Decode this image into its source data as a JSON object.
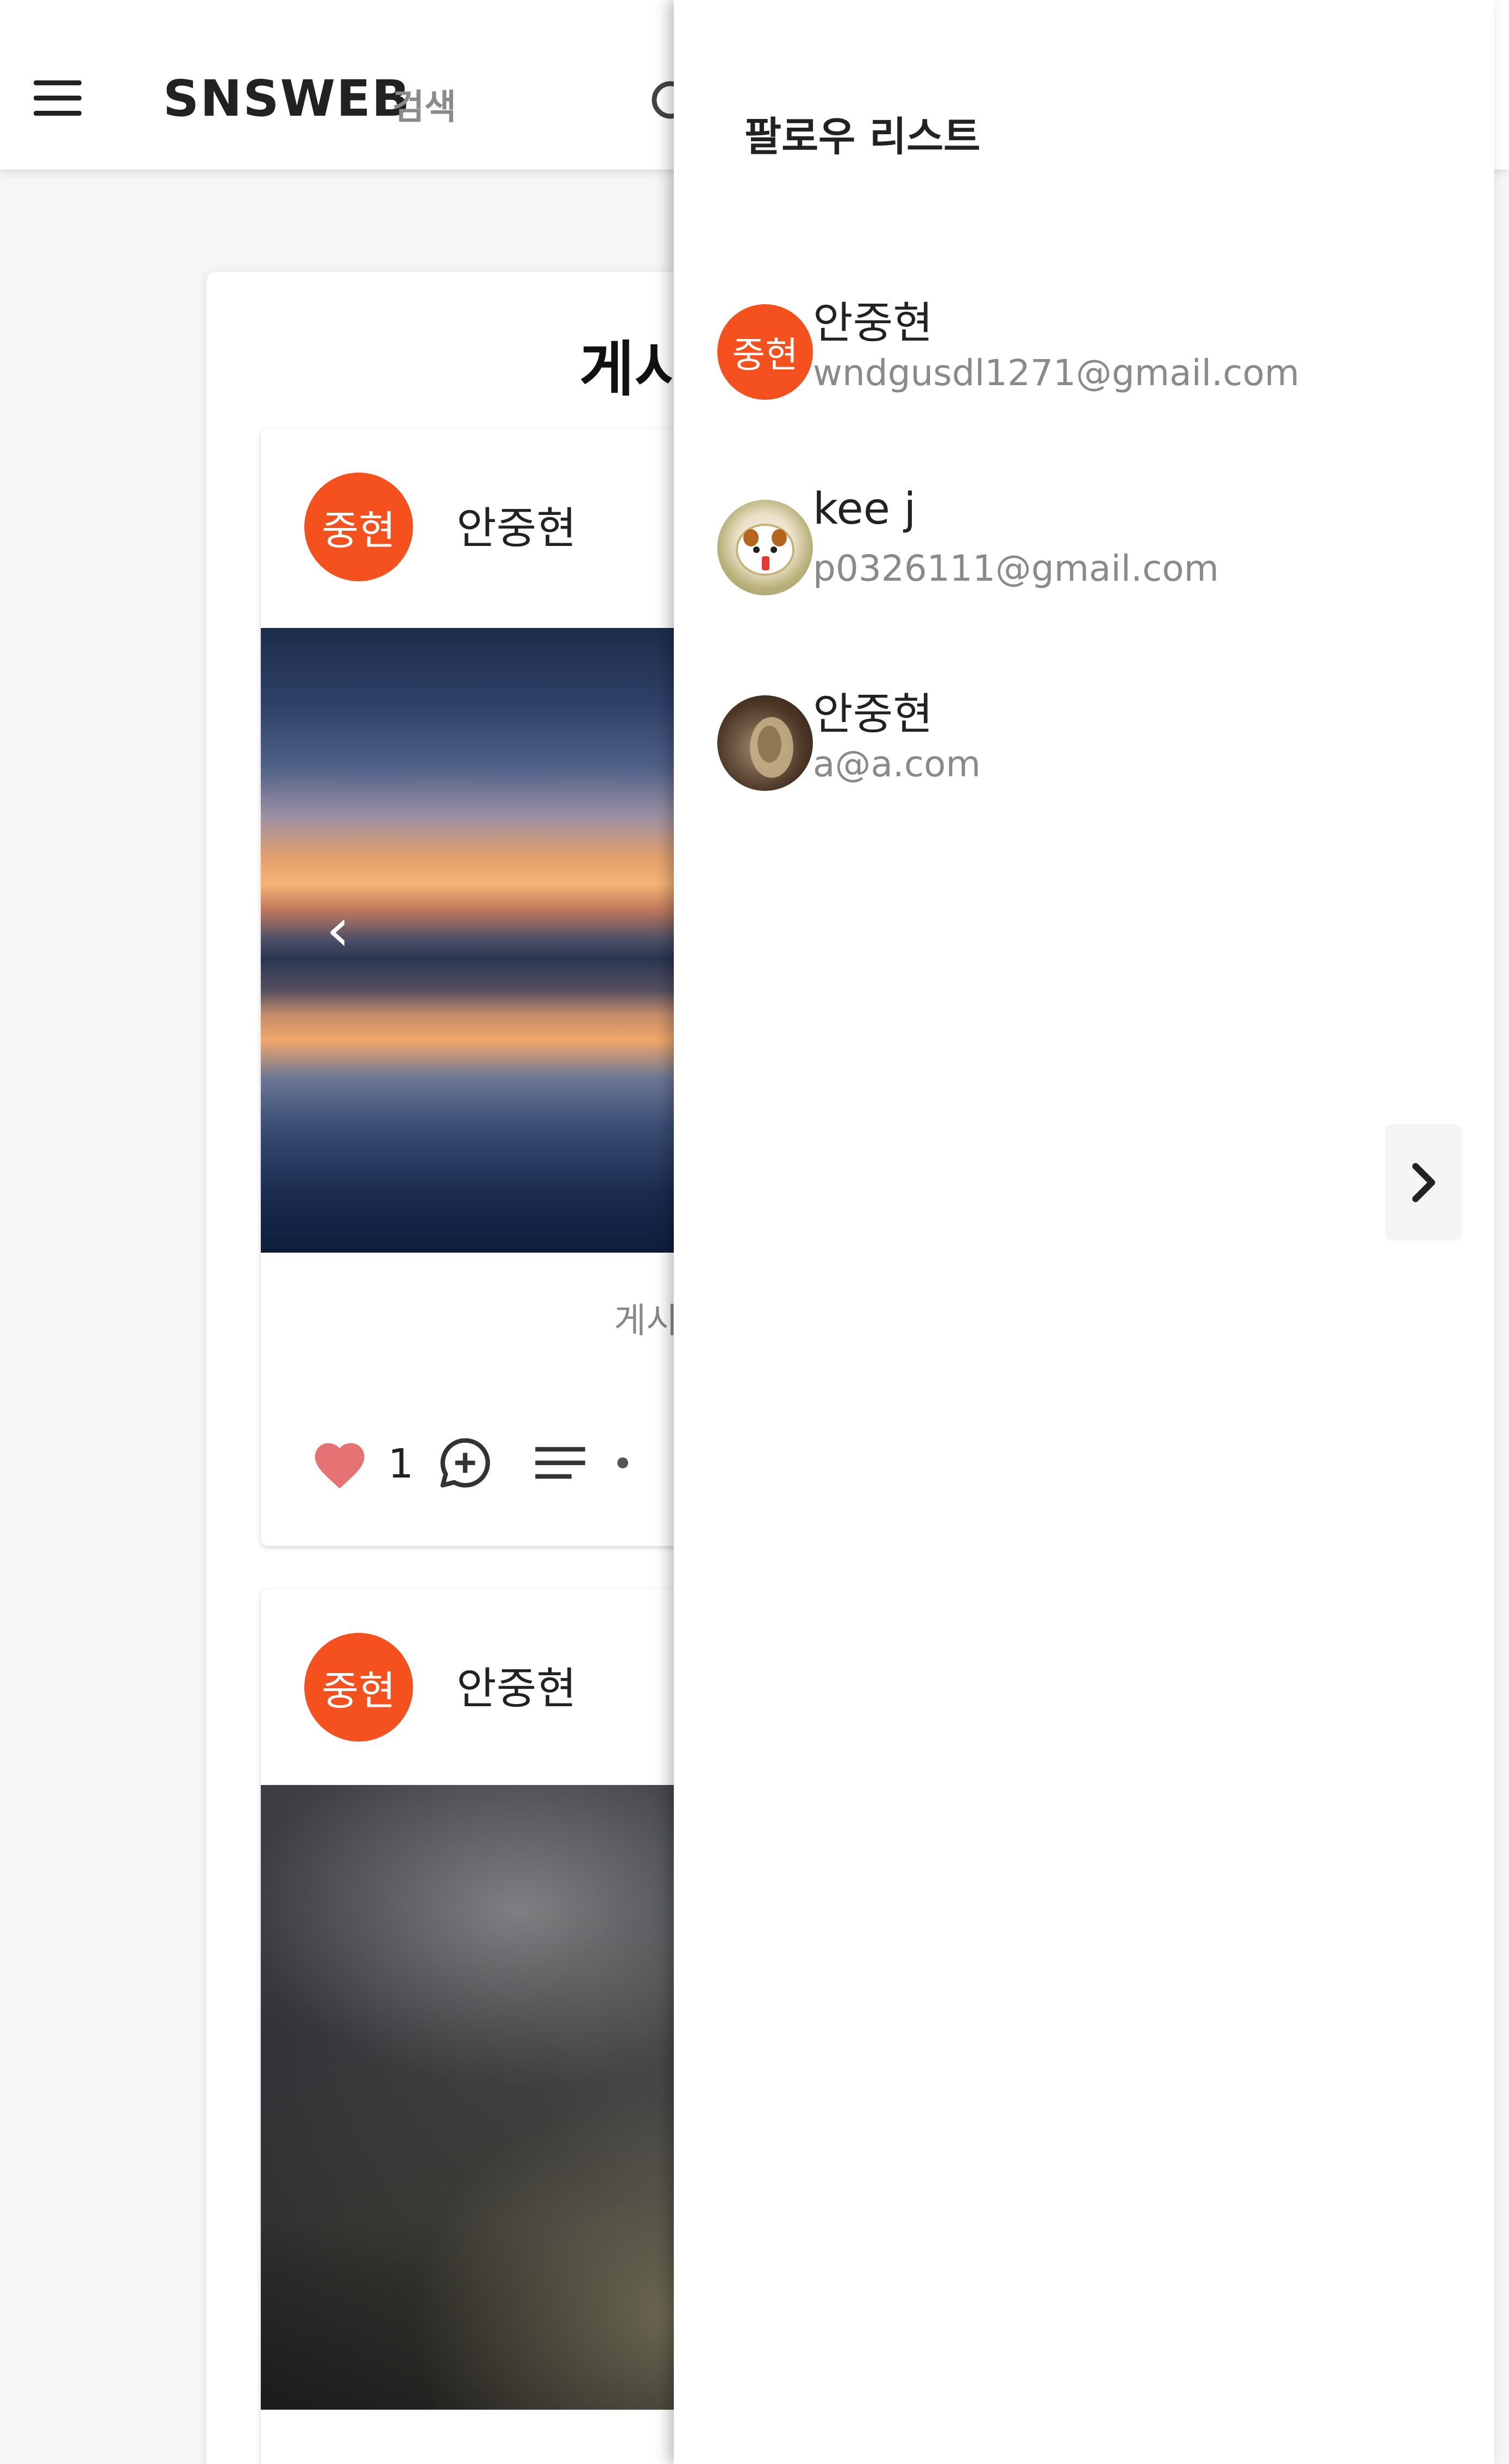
{
  "header": {
    "brand": "SNSWEB",
    "search_label": "검색",
    "menu_icon": "hamburger-menu-icon",
    "search_icon": "search-icon"
  },
  "main": {
    "page_heading": "게시",
    "posts": [
      {
        "avatar_text": "중현",
        "author": "안중현",
        "image": "sunset-reflection-photo",
        "caption": "게시",
        "likes": "1"
      },
      {
        "avatar_text": "중현",
        "author": "안중현",
        "image": "night-sky-clouds-photo"
      }
    ]
  },
  "drawer": {
    "title": "팔로우 리스트",
    "follows": [
      {
        "avatar_text": "중현",
        "name": "안중현",
        "email": "wndgusdl1271@gmail.com"
      },
      {
        "avatar_text": "",
        "name": "kee j",
        "email": "p0326111@gmail.com"
      },
      {
        "avatar_text": "",
        "name": "안중현",
        "email": "a@a.com"
      }
    ],
    "edge_button_icon": "chevron-right-icon"
  },
  "colors": {
    "avatar_orange": "#f4511e",
    "like_heart": "#e57373",
    "muted_text": "#8a8a8a"
  }
}
